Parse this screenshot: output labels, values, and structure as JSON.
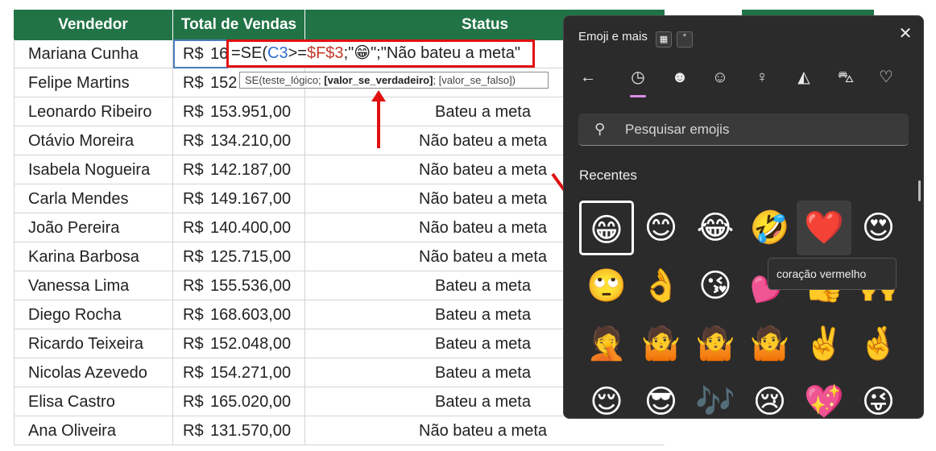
{
  "headers": {
    "vendedor": "Vendedor",
    "total": "Total de Vendas",
    "status": "Status"
  },
  "rows": [
    {
      "name": "Mariana Cunha",
      "cur": "R$",
      "amt": "16",
      "status": ""
    },
    {
      "name": "Felipe Martins",
      "cur": "R$",
      "amt": "152",
      "status": ""
    },
    {
      "name": "Leonardo Ribeiro",
      "cur": "R$",
      "amt": "153.951,00",
      "status": "Bateu a meta"
    },
    {
      "name": "Otávio Moreira",
      "cur": "R$",
      "amt": "134.210,00",
      "status": "Não bateu a meta"
    },
    {
      "name": "Isabela Nogueira",
      "cur": "R$",
      "amt": "142.187,00",
      "status": "Não bateu a meta"
    },
    {
      "name": "Carla Mendes",
      "cur": "R$",
      "amt": "149.167,00",
      "status": "Não bateu a meta"
    },
    {
      "name": "João Pereira",
      "cur": "R$",
      "amt": "140.400,00",
      "status": "Não bateu a meta"
    },
    {
      "name": "Karina Barbosa",
      "cur": "R$",
      "amt": "125.715,00",
      "status": "Não bateu a meta"
    },
    {
      "name": "Vanessa Lima",
      "cur": "R$",
      "amt": "155.536,00",
      "status": "Bateu a meta"
    },
    {
      "name": "Diego Rocha",
      "cur": "R$",
      "amt": "168.603,00",
      "status": "Bateu a meta"
    },
    {
      "name": "Ricardo Teixeira",
      "cur": "R$",
      "amt": "152.048,00",
      "status": "Bateu a meta"
    },
    {
      "name": "Nicolas Azevedo",
      "cur": "R$",
      "amt": "154.271,00",
      "status": "Bateu a meta"
    },
    {
      "name": "Elisa Castro",
      "cur": "R$",
      "amt": "165.020,00",
      "status": "Bateu a meta"
    },
    {
      "name": "Ana Oliveira",
      "cur": "R$",
      "amt": "131.570,00",
      "status": "Não bateu a meta"
    }
  ],
  "formula": {
    "p1": "=SE(",
    "ref1": "C3",
    "p2": ">=",
    "ref2": "$F$3",
    "p3": ";\"😁\";\"Não bateu a meta\""
  },
  "tooltip": {
    "p1": "SE(teste_lógico; ",
    "bold": "[valor_se_verdadeiro]",
    "p2": "; [valor_se_falso])"
  },
  "emoji_panel": {
    "title": "Emoji e mais",
    "search_placeholder": "Pesquisar emojis",
    "section": "Recentes",
    "hover_label": "coração vermelho",
    "close": "✕",
    "categories": [
      "recent-clock-icon",
      "smiley-icon",
      "cat-face-icon",
      "people-icon",
      "party-icon",
      "car-icon",
      "heart-icon"
    ],
    "emojis": [
      "😁",
      "😊",
      "😂",
      "🤣",
      "❤️",
      "😍",
      "🙄",
      "👌",
      "😘",
      "💕",
      "👍",
      "🙌",
      "🤦",
      "🤷",
      "🤷",
      "🤷",
      "✌️",
      "🤞",
      "😌",
      "😎",
      "🎶",
      "😢",
      "💖",
      "😜"
    ]
  },
  "colors": {
    "header_green": "#217346",
    "highlight_red": "#e01010",
    "panel_bg": "#2b2b2b",
    "accent_purple": "#d98ce8"
  }
}
